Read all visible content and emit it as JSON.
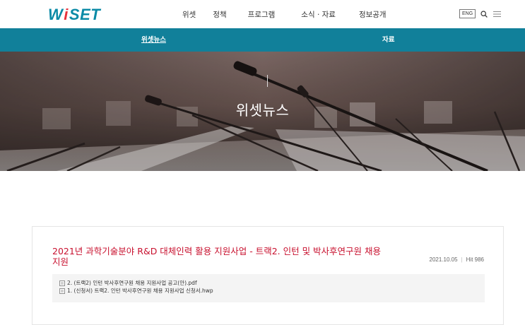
{
  "header": {
    "logo": {
      "w": "W",
      "dot": "i",
      "rest": "SET"
    },
    "nav": [
      "위셋",
      "정책",
      "프로그램",
      "소식 · 자료",
      "정보공개"
    ],
    "lang_button": "ENG"
  },
  "subnav": {
    "tabs": [
      {
        "label": "위셋뉴스",
        "active": true
      },
      {
        "label": "자료",
        "active": false
      }
    ]
  },
  "hero": {
    "title": "위셋뉴스"
  },
  "post": {
    "title": "2021년 과학기술분야 R&D 대체인력 활용 지원사업 - 트랙2. 인턴 및 박사후연구원 채용 지원",
    "date": "2021.10.05",
    "hits": "Hit 986",
    "attachments": [
      "2. (트랙2) 인턴 박사후연구원 채용 지원사업 공고(안).pdf",
      "1. (신청서) 트랙2. 인턴 박사후연구원 채용 지원사업 신청서.hwp"
    ]
  },
  "colors": {
    "brand": "#0a8aa6",
    "subnav": "#11809a",
    "title_red": "#c8102e",
    "logo_dot": "#e8323c"
  },
  "icons": [
    "search-icon",
    "hamburger-menu-icon",
    "file-icon"
  ]
}
